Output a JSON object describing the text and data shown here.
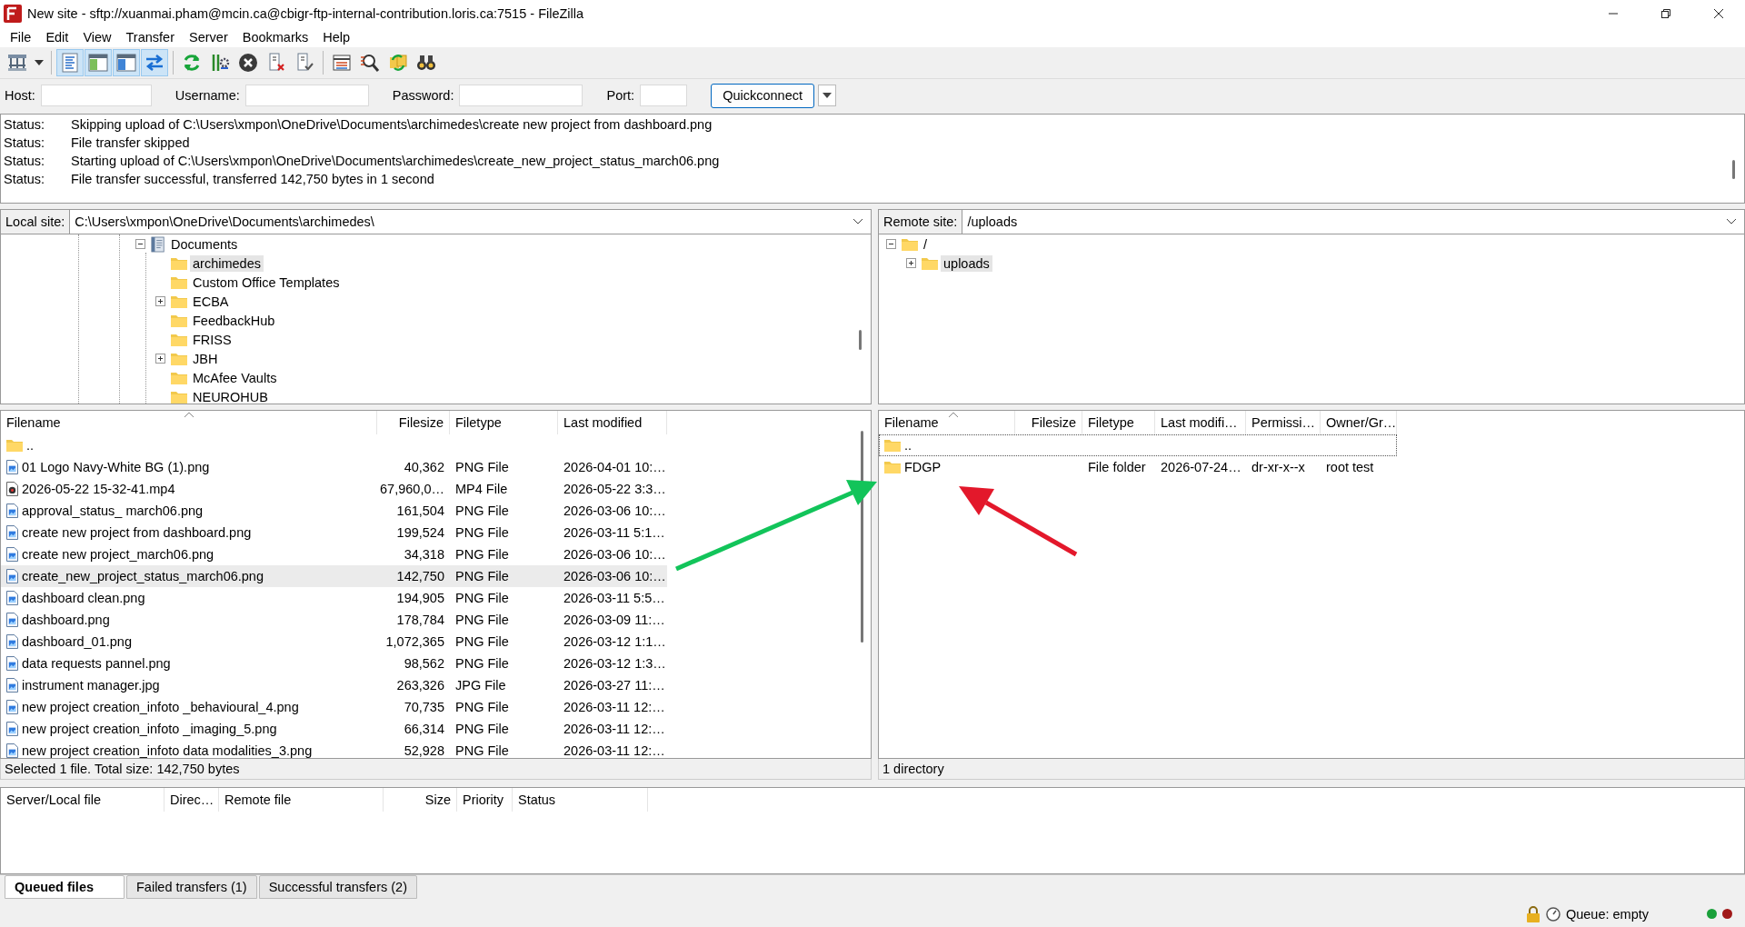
{
  "window": {
    "title": "New site - sftp://xuanmai.pham@mcin.ca@cbigr-ftp-internal-contribution.loris.ca:7515 - FileZilla"
  },
  "menu": [
    "File",
    "Edit",
    "View",
    "Transfer",
    "Server",
    "Bookmarks",
    "Help"
  ],
  "toolbar": [
    {
      "kind": "sitemanager",
      "pressed": false
    },
    {
      "kind": "dropdown",
      "pressed": false
    },
    {
      "kind": "separator"
    },
    {
      "kind": "log",
      "pressed": true
    },
    {
      "kind": "localtree",
      "pressed": true
    },
    {
      "kind": "remotetree",
      "pressed": true
    },
    {
      "kind": "transfers",
      "pressed": true
    },
    {
      "kind": "separator"
    },
    {
      "kind": "refresh",
      "pressed": false
    },
    {
      "kind": "process",
      "pressed": false
    },
    {
      "kind": "cancel",
      "pressed": false
    },
    {
      "kind": "disconnect",
      "pressed": false
    },
    {
      "kind": "reconnect",
      "pressed": false
    },
    {
      "kind": "separator"
    },
    {
      "kind": "listing",
      "pressed": false
    },
    {
      "kind": "filter",
      "pressed": false
    },
    {
      "kind": "sync",
      "pressed": false
    },
    {
      "kind": "binoculars",
      "pressed": false
    }
  ],
  "quickconnect": {
    "fields": [
      {
        "label": "Host:"
      },
      {
        "label": "Username:"
      },
      {
        "label": "Password:"
      },
      {
        "label": "Port:"
      }
    ],
    "button": "Quickconnect"
  },
  "log": [
    {
      "label": "Status:",
      "message": "Skipping upload of C:\\Users\\xmpon\\OneDrive\\Documents\\archimedes\\create new project from dashboard.png"
    },
    {
      "label": "Status:",
      "message": "File transfer skipped"
    },
    {
      "label": "Status:",
      "message": "Starting upload of C:\\Users\\xmpon\\OneDrive\\Documents\\archimedes\\create_new_project_status_march06.png"
    },
    {
      "label": "Status:",
      "message": "File transfer successful, transferred 142,750 bytes in 1 second"
    }
  ],
  "local_site": {
    "label": "Local site:",
    "path": "C:\\Users\\xmpon\\OneDrive\\Documents\\archimedes\\",
    "tree": [
      {
        "label": "Documents",
        "kind": "documents",
        "expanded": true,
        "selected": false,
        "children": [
          {
            "label": "archimedes",
            "kind": "folder",
            "selected": true
          },
          {
            "label": "Custom Office Templates",
            "kind": "folder",
            "selected": false
          },
          {
            "label": "ECBA",
            "kind": "folder",
            "expanded": false,
            "selected": false
          },
          {
            "label": "FeedbackHub",
            "kind": "folder",
            "selected": false
          },
          {
            "label": "FRISS",
            "kind": "folder",
            "selected": false
          },
          {
            "label": "JBH",
            "kind": "folder",
            "expanded": false,
            "selected": false
          },
          {
            "label": "McAfee Vaults",
            "kind": "folder",
            "selected": false
          },
          {
            "label": "NEUROHUB",
            "kind": "folder",
            "selected": false
          }
        ]
      }
    ],
    "columns": [
      "Filename",
      "Filesize",
      "Filetype",
      "Last modified"
    ],
    "files": [
      {
        "kind": "folder",
        "cells": [
          ".."
        ],
        "selected": false
      },
      {
        "kind": "image",
        "cells": [
          "01 Logo Navy-White BG (1).png",
          "40,362",
          "PNG File",
          "2026-04-01 10:…"
        ],
        "selected": false
      },
      {
        "kind": "video",
        "cells": [
          "2026-05-22 15-32-41.mp4",
          "67,960,0…",
          "MP4 File",
          "2026-05-22 3:3…"
        ],
        "selected": false
      },
      {
        "kind": "image",
        "cells": [
          "approval_status_ march06.png",
          "161,504",
          "PNG File",
          "2026-03-06 10:…"
        ],
        "selected": false
      },
      {
        "kind": "image",
        "cells": [
          "create new project from dashboard.png",
          "199,524",
          "PNG File",
          "2026-03-11 5:1…"
        ],
        "selected": false
      },
      {
        "kind": "image",
        "cells": [
          "create new project_march06.png",
          "34,318",
          "PNG File",
          "2026-03-06 10:…"
        ],
        "selected": false
      },
      {
        "kind": "image",
        "cells": [
          "create_new_project_status_march06.png",
          "142,750",
          "PNG File",
          "2026-03-06 10:…"
        ],
        "selected": true
      },
      {
        "kind": "image",
        "cells": [
          "dashboard clean.png",
          "194,905",
          "PNG File",
          "2026-03-11 5:5…"
        ],
        "selected": false
      },
      {
        "kind": "image",
        "cells": [
          "dashboard.png",
          "178,784",
          "PNG File",
          "2026-03-09 11:…"
        ],
        "selected": false
      },
      {
        "kind": "image",
        "cells": [
          "dashboard_01.png",
          "1,072,365",
          "PNG File",
          "2026-03-12 1:1…"
        ],
        "selected": false
      },
      {
        "kind": "image",
        "cells": [
          "data requests pannel.png",
          "98,562",
          "PNG File",
          "2026-03-12 1:3…"
        ],
        "selected": false
      },
      {
        "kind": "image",
        "cells": [
          "instrument manager.jpg",
          "263,326",
          "JPG File",
          "2026-03-27 11:…"
        ],
        "selected": false
      },
      {
        "kind": "image",
        "cells": [
          "new project creation_infoto _behavioural_4.png",
          "70,735",
          "PNG File",
          "2026-03-11 12:…"
        ],
        "selected": false
      },
      {
        "kind": "image",
        "cells": [
          "new project creation_infoto _imaging_5.png",
          "66,314",
          "PNG File",
          "2026-03-11 12:…"
        ],
        "selected": false
      },
      {
        "kind": "image",
        "cells": [
          "new project creation_infoto data modalities_3.png",
          "52,928",
          "PNG File",
          "2026-03-11 12:…"
        ],
        "selected": false
      }
    ],
    "status": "Selected 1 file. Total size: 142,750 bytes"
  },
  "remote_site": {
    "label": "Remote site:",
    "path": "/uploads",
    "tree": [
      {
        "label": "/",
        "kind": "folder",
        "expanded": true,
        "selected": false,
        "children": [
          {
            "label": "uploads",
            "kind": "folder",
            "expanded": false,
            "selected": true
          }
        ]
      }
    ],
    "columns": [
      "Filename",
      "Filesize",
      "Filetype",
      "Last modifi…",
      "Permissi…",
      "Owner/Gr…"
    ],
    "files": [
      {
        "kind": "folder",
        "cells": [
          ".."
        ],
        "selected": false,
        "focused": true
      },
      {
        "kind": "folder",
        "cells": [
          "FDGP",
          "",
          "File folder",
          "2026-07-24…",
          "dr-xr-x--x",
          "root test"
        ],
        "selected": false,
        "focused": false
      }
    ],
    "status": "1 directory"
  },
  "queue": {
    "columns": [
      "Server/Local file",
      "Direc…",
      "Remote file",
      "Size",
      "Priority",
      "Status"
    ]
  },
  "queue_tabs": [
    {
      "label": "Queued files",
      "selected": true
    },
    {
      "label": "Failed transfers (1)",
      "selected": false
    },
    {
      "label": "Successful transfers (2)",
      "selected": false
    }
  ],
  "status_bar": {
    "queue": "Queue: empty"
  },
  "annotations": [
    {
      "kind": "arrow",
      "color": "#12c45a"
    },
    {
      "kind": "arrow",
      "color": "#e3182b"
    }
  ]
}
